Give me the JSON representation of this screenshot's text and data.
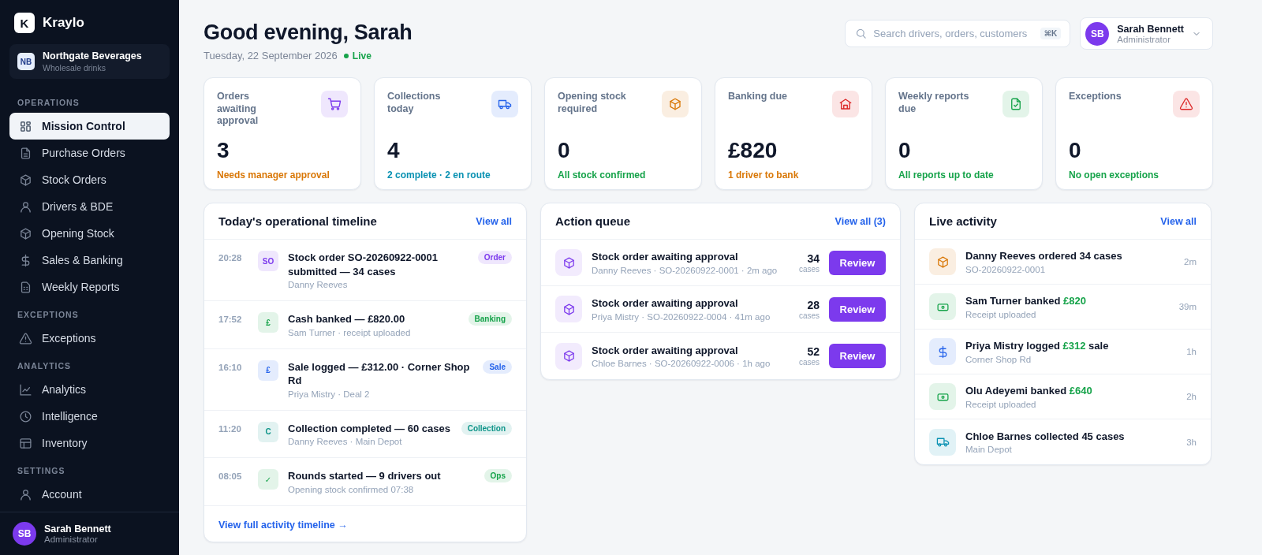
{
  "sidebar": {
    "brand": {
      "mark": "K",
      "name": "Kraylo"
    },
    "org": {
      "initials": "NB",
      "name": "Northgate Beverages",
      "subtitle": "Wholesale drinks"
    },
    "sections": [
      {
        "title": "OPERATIONS",
        "items": [
          {
            "label": "Mission Control",
            "kind": "grid",
            "selected": true
          },
          {
            "label": "Purchase Orders",
            "kind": "file",
            "selected": false
          },
          {
            "label": "Stock Orders",
            "kind": "box",
            "selected": false
          },
          {
            "label": "Drivers & BDE",
            "kind": "user",
            "selected": false
          },
          {
            "label": "Opening Stock",
            "kind": "cube",
            "selected": false
          },
          {
            "label": "Sales & Banking",
            "kind": "dollar",
            "selected": false
          },
          {
            "label": "Weekly Reports",
            "kind": "report",
            "selected": false
          }
        ]
      },
      {
        "title": "EXCEPTIONS",
        "items": [
          {
            "label": "Exceptions",
            "kind": "alert",
            "selected": false
          }
        ]
      },
      {
        "title": "ANALYTICS",
        "items": [
          {
            "label": "Analytics",
            "kind": "chart",
            "selected": false
          },
          {
            "label": "Intelligence",
            "kind": "clock",
            "selected": false
          },
          {
            "label": "Inventory",
            "kind": "table",
            "selected": false
          }
        ]
      },
      {
        "title": "SETTINGS",
        "items": [
          {
            "label": "Account",
            "kind": "user",
            "selected": false
          }
        ]
      }
    ],
    "user": {
      "initials": "SB",
      "name": "Sarah Bennett",
      "role": "Administrator"
    }
  },
  "header": {
    "greeting": "Good evening, Sarah",
    "date": "Tuesday, 22 September 2026",
    "live": "Live",
    "search": {
      "placeholder": "Search drivers, orders, customers",
      "shortcut": "⌘K"
    },
    "user": {
      "initials": "SB",
      "name": "Sarah Bennett",
      "role": "Administrator"
    }
  },
  "stats": [
    {
      "label": "Orders awaiting approval",
      "value": "3",
      "note": {
        "text": "Needs manager approval",
        "color": "#d97706"
      },
      "kind": "cart",
      "color": "#7c3aed"
    },
    {
      "label": "Collections today",
      "value": "4",
      "note": {
        "text": "2 complete · 2 en route",
        "color": "#0891b2"
      },
      "kind": "truck",
      "color": "#2563eb"
    },
    {
      "label": "Opening stock required",
      "value": "0",
      "note": {
        "text": "All stock confirmed",
        "color": "#16a34a"
      },
      "kind": "box",
      "color": "#d97706"
    },
    {
      "label": "Banking due",
      "value": "£820",
      "note": {
        "text": "1 driver to bank",
        "color": "#d97706"
      },
      "kind": "bank",
      "color": "#dc2626"
    },
    {
      "label": "Weekly reports due",
      "value": "0",
      "note": {
        "text": "All reports up to date",
        "color": "#16a34a"
      },
      "kind": "filecheck",
      "color": "#16a34a"
    },
    {
      "label": "Exceptions",
      "value": "0",
      "note": {
        "text": "No open exceptions",
        "color": "#16a34a"
      },
      "kind": "alert",
      "color": "#dc2626"
    }
  ],
  "timeline": {
    "title": "Today's operational timeline",
    "link": "View all",
    "footer_link": "View full activity timeline →",
    "items": [
      {
        "time": "20:28",
        "glyph": "SO",
        "title": "Stock order SO-20260922-0001 submitted — 34 cases",
        "meta": "Danny Reeves",
        "tag": "Order",
        "color": "#7c3aed"
      },
      {
        "time": "17:52",
        "glyph": "£",
        "title": "Cash banked — £820.00",
        "meta": "Sam Turner · receipt uploaded",
        "tag": "Banking",
        "color": "#16a34a"
      },
      {
        "time": "16:10",
        "glyph": "£",
        "title": "Sale logged — £312.00 · Corner Shop Rd",
        "meta": "Priya Mistry · Deal 2",
        "tag": "Sale",
        "color": "#2563eb"
      },
      {
        "time": "11:20",
        "glyph": "C",
        "title": "Collection completed — 60 cases",
        "meta": "Danny Reeves · Main Depot",
        "tag": "Collection",
        "color": "#0d9488"
      },
      {
        "time": "08:05",
        "glyph": "✓",
        "title": "Rounds started — 9 drivers out",
        "meta": "Opening stock confirmed 07:38",
        "tag": "Ops",
        "color": "#16a34a"
      }
    ]
  },
  "action_queue": {
    "title": "Action queue",
    "link": "View all (3)",
    "items": [
      {
        "title": "Stock order awaiting approval",
        "meta": "Danny Reeves · SO-20260922-0001 · 2m ago",
        "count": "34",
        "unit": "cases",
        "button": "Review"
      },
      {
        "title": "Stock order awaiting approval",
        "meta": "Priya Mistry · SO-20260922-0004 · 41m ago",
        "count": "28",
        "unit": "cases",
        "button": "Review"
      },
      {
        "title": "Stock order awaiting approval",
        "meta": "Chloe Barnes · SO-20260922-0006 · 1h ago",
        "count": "52",
        "unit": "cases",
        "button": "Review"
      }
    ]
  },
  "live_activity": {
    "title": "Live activity",
    "link": "View all",
    "items": [
      {
        "kind": "box",
        "color": "#d97706",
        "title": "Danny Reeves ordered 34 cases",
        "meta": "SO-20260922-0001",
        "time": "2m"
      },
      {
        "kind": "cash",
        "color": "#16a34a",
        "title": "Sam Turner banked",
        "amount": "£820",
        "meta": "Receipt uploaded",
        "time": "39m"
      },
      {
        "kind": "dollar",
        "color": "#2563eb",
        "title": "Priya Mistry logged",
        "amount": "£312",
        "after": "sale",
        "meta": "Corner Shop Rd",
        "time": "1h"
      },
      {
        "kind": "cash",
        "color": "#16a34a",
        "title": "Olu Adeyemi banked",
        "amount": "£640",
        "meta": "Receipt uploaded",
        "time": "2h"
      },
      {
        "kind": "truck",
        "color": "#0891b2",
        "title": "Chloe Barnes collected 45 cases",
        "meta": "Main Depot",
        "time": "3h"
      }
    ]
  }
}
